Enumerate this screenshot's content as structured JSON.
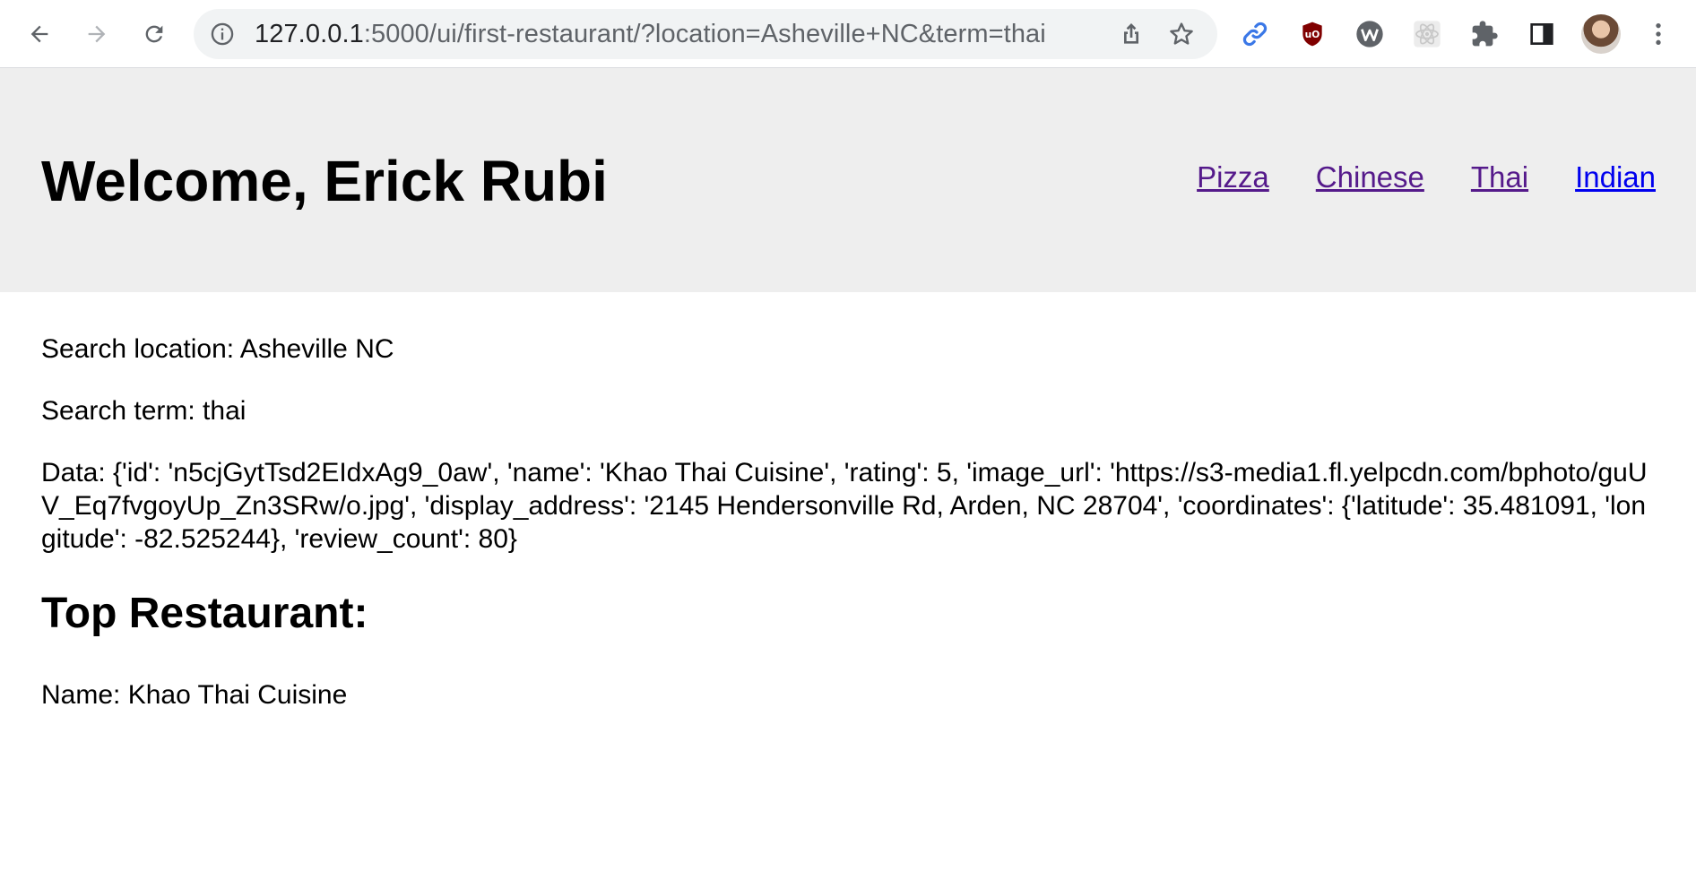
{
  "browser": {
    "url_host": "127.0.0.1",
    "url_rest": ":5000/ui/first-restaurant/?location=Asheville+NC&term=thai",
    "icons": {
      "back": "arrow-left-icon",
      "forward": "arrow-right-icon",
      "reload": "reload-icon",
      "site_info": "info-icon",
      "share": "share-icon",
      "bookmark": "star-icon",
      "extensions": [
        "link-icon",
        "ublock-icon",
        "w-icon",
        "react-icon",
        "puzzle-icon",
        "side-panel-icon"
      ],
      "menu": "kebab-menu-icon"
    }
  },
  "header": {
    "welcome": "Welcome, Erick Rubi",
    "nav": [
      {
        "label": "Pizza",
        "visited": true
      },
      {
        "label": "Chinese",
        "visited": true
      },
      {
        "label": "Thai",
        "visited": true
      },
      {
        "label": "Indian",
        "visited": false
      }
    ],
    "background": "#eeeeee",
    "visited_link_color": "#551a8b",
    "link_color": "#0000ee"
  },
  "main": {
    "search_location": "Search location: Asheville NC",
    "search_term": "Search term: thai",
    "data_line": "Data: {'id': 'n5cjGytTsd2EIdxAg9_0aw', 'name': 'Khao Thai Cuisine', 'rating': 5, 'image_url': 'https://s3-media1.fl.yelpcdn.com/bphoto/guUV_Eq7fvgoyUp_Zn3SRw/o.jpg', 'display_address': '2145 Hendersonville Rd, Arden, NC 28704', 'coordinates': {'latitude': 35.481091, 'longitude': -82.525244}, 'review_count': 80}",
    "top_heading": "Top Restaurant:",
    "name_line": "Name: Khao Thai Cuisine"
  }
}
